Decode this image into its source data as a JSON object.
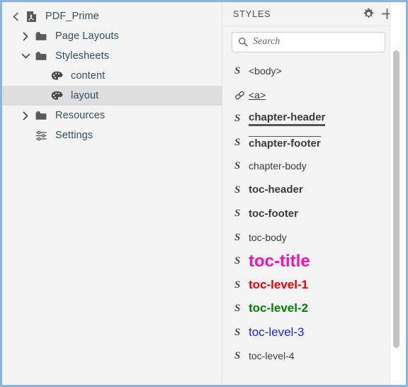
{
  "window": {
    "border_color": "#8cb4e2",
    "panel_bg": "#f4f4f4"
  },
  "tree": {
    "back_button_icon": "chevron-left-icon",
    "root": {
      "icon": "pdf-document-icon",
      "label": "PDF_Prime"
    },
    "items": [
      {
        "label": "Page Layouts",
        "icon": "folder-icon",
        "twisty": "chevron-right-icon",
        "indent": 1,
        "selected": false
      },
      {
        "label": "Stylesheets",
        "icon": "folder-icon",
        "twisty": "chevron-down-icon",
        "indent": 1,
        "selected": false
      },
      {
        "label": "content",
        "icon": "palette-icon",
        "twisty": "",
        "indent": 2,
        "selected": false
      },
      {
        "label": "layout",
        "icon": "palette-icon",
        "twisty": "",
        "indent": 2,
        "selected": true
      },
      {
        "label": "Resources",
        "icon": "folder-icon",
        "twisty": "chevron-right-icon",
        "indent": 1,
        "selected": false
      },
      {
        "label": "Settings",
        "icon": "sliders-icon",
        "twisty": "",
        "indent": 1,
        "selected": false
      }
    ]
  },
  "styles_panel": {
    "title": "STYLES",
    "settings_icon": "gear-icon",
    "add_icon": "plus-icon",
    "search": {
      "icon": "search-icon",
      "value": "",
      "placeholder": "Search"
    },
    "filter_icon": "filter-funnel-icon",
    "items": [
      {
        "icon": "style-s-icon",
        "label": "<body>",
        "variant": "sv-plain"
      },
      {
        "icon": "chain-link-icon",
        "label": "<a>",
        "variant": "sv-link"
      },
      {
        "icon": "style-s-icon",
        "label": "chapter-header",
        "variant": "sv-bold-under"
      },
      {
        "icon": "style-s-icon",
        "label": "chapter-footer",
        "variant": "sv-bold-over"
      },
      {
        "icon": "style-s-icon",
        "label": "chapter-body",
        "variant": "sv-plain"
      },
      {
        "icon": "style-s-icon",
        "label": "toc-header",
        "variant": "sv-bold"
      },
      {
        "icon": "style-s-icon",
        "label": "toc-footer",
        "variant": "sv-bold"
      },
      {
        "icon": "style-s-icon",
        "label": "toc-body",
        "variant": "sv-plain"
      },
      {
        "icon": "style-s-icon",
        "label": "toc-title",
        "variant": "sv-big-mag"
      },
      {
        "icon": "style-s-icon",
        "label": "toc-level-1",
        "variant": "sv-red"
      },
      {
        "icon": "style-s-icon",
        "label": "toc-level-2",
        "variant": "sv-green"
      },
      {
        "icon": "style-s-icon",
        "label": "toc-level-3",
        "variant": "sv-blue"
      },
      {
        "icon": "style-s-icon",
        "label": "toc-level-4",
        "variant": "sv-plain"
      }
    ],
    "s_glyph": "S",
    "colors": {
      "magenta": "#f012be",
      "red": "#ee0000",
      "green": "#008000",
      "blue": "#2020ff"
    }
  }
}
